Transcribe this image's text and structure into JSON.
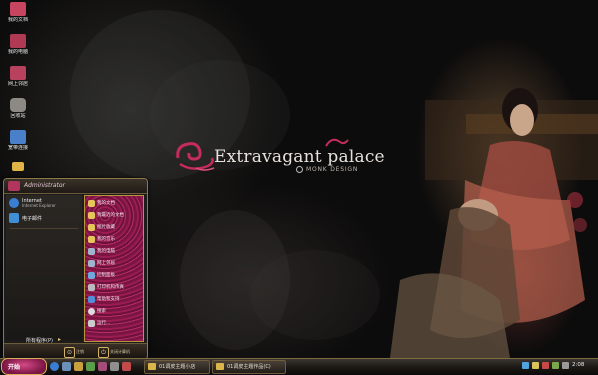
{
  "desktop": {
    "icons": [
      {
        "label": "我的文档",
        "icon": "documents-icon",
        "color": "#c8455f"
      },
      {
        "label": "我的电脑",
        "icon": "computer-icon",
        "color": "#b03a54"
      },
      {
        "label": "网上邻居",
        "icon": "network-icon",
        "color": "#b8415d"
      },
      {
        "label": "回收站",
        "icon": "recycle-bin-icon",
        "color": "#8d8a85"
      },
      {
        "label": "宽带连接",
        "icon": "broadband-icon",
        "color": "#4a7fc9"
      },
      {
        "label": "",
        "icon": "folder-icon",
        "color": "#e0b545"
      }
    ]
  },
  "wallpaper": {
    "title": "Extravagant palace",
    "subtitle": "MONK DESIGN",
    "accent": "#c42c5c"
  },
  "start_menu": {
    "user_name": "Administrator",
    "pinned": [
      {
        "title": "Internet",
        "subtitle": "Internet Explorer",
        "icon": "ie-icon",
        "color": "#3a7ed2"
      },
      {
        "title": "电子邮件",
        "subtitle": "",
        "icon": "email-icon",
        "color": "#3f8ed6"
      }
    ],
    "right_items": [
      {
        "label": "我的文档",
        "icon": "documents-icon",
        "color": "#e6c55a"
      },
      {
        "label": "我最近的文档",
        "icon": "recent-icon",
        "color": "#e6c55a"
      },
      {
        "label": "图片收藏",
        "icon": "pictures-icon",
        "color": "#e6c55a"
      },
      {
        "label": "我的音乐",
        "icon": "music-icon",
        "color": "#e6c55a"
      },
      {
        "label": "我的电脑",
        "icon": "computer-icon",
        "color": "#a0b4cc"
      },
      {
        "label": "网上邻居",
        "icon": "network-icon",
        "color": "#a0b4cc"
      },
      {
        "label": "控制面板",
        "icon": "control-panel-icon",
        "color": "#6fa8dc"
      },
      {
        "label": "打印机和传真",
        "icon": "printer-icon",
        "color": "#bbbbbb"
      },
      {
        "label": "帮助和支持",
        "icon": "help-icon",
        "color": "#4f8fd6"
      },
      {
        "label": "搜索",
        "icon": "search-icon",
        "color": "#dddddd"
      },
      {
        "label": "运行...",
        "icon": "run-icon",
        "color": "#cccccc"
      }
    ],
    "all_programs": "所有程序(P)",
    "logoff_label": "注销",
    "shutdown_label": "关闭计算机"
  },
  "taskbar": {
    "start_label": "开始",
    "buttons": [
      {
        "label": "01调皮主题小店",
        "icon": "folder-icon"
      },
      {
        "label": "01调皮主题作品(C)",
        "icon": "folder-icon"
      }
    ],
    "clock": "2:08"
  }
}
